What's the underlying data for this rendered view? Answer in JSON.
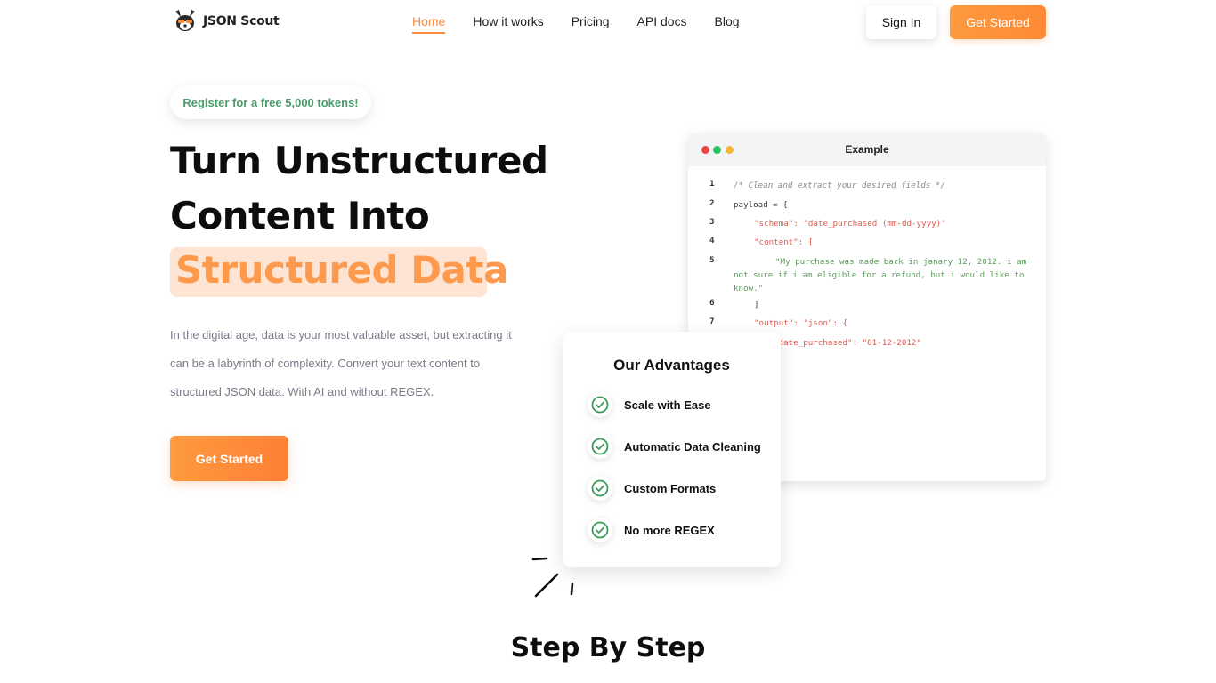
{
  "brand": {
    "name": "JSON Scout"
  },
  "nav": {
    "items": [
      {
        "label": "Home",
        "active": true
      },
      {
        "label": "How it works",
        "active": false
      },
      {
        "label": "Pricing",
        "active": false
      },
      {
        "label": "API docs",
        "active": false
      },
      {
        "label": "Blog",
        "active": false
      }
    ],
    "sign_in": "Sign In",
    "get_started": "Get Started"
  },
  "hero": {
    "promo": "Register for a free 5,000 tokens!",
    "title_line1": "Turn Unstructured",
    "title_line2": "Content Into",
    "title_highlight": "Structured Data",
    "description": "In the digital age, data is your most valuable asset, but extracting it can be a labyrinth of complexity. Convert your text content to structured JSON data. With AI and without REGEX.",
    "cta": "Get Started"
  },
  "example": {
    "title": "Example",
    "lines": [
      {
        "num": "1",
        "text": "/* Clean and extract your desired fields */"
      },
      {
        "num": "2",
        "text": "payload = {"
      },
      {
        "num": "3",
        "text": "\"schema\": \"date_purchased (mm-dd-yyyy)\""
      },
      {
        "num": "4",
        "text": "\"content\": ["
      },
      {
        "num": "5",
        "text": "\"My purchase was made back in janary 12, 2012. i am not sure if i am eligible for a refund, but i would like to know.\""
      },
      {
        "num": "6",
        "text": "]"
      },
      {
        "num": "7",
        "text": "\"output\": \"json\": {"
      },
      {
        "num": "",
        "text": "\"date_purchased\": \"01-12-2012\""
      }
    ]
  },
  "advantages": {
    "title": "Our Advantages",
    "items": [
      "Scale with Ease",
      "Automatic Data Cleaning",
      "Custom Formats",
      "No more REGEX"
    ]
  },
  "steps": {
    "title": "Step By Step"
  },
  "colors": {
    "accent": "#fb8a3c",
    "highlight_bg": "#fde4d3",
    "promo_text": "#4a9c6a",
    "check": "#3b9a5c"
  }
}
